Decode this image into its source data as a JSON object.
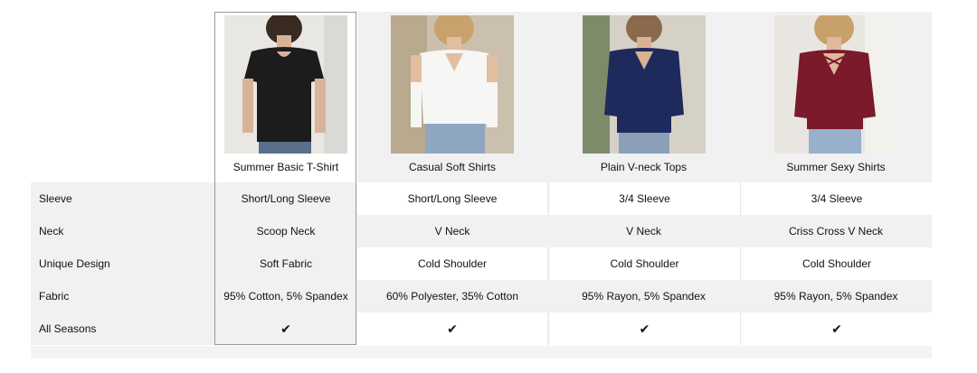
{
  "products": [
    {
      "name": "Summer Basic T-Shirt",
      "image_icon": "black-tshirt-photo",
      "color": "#1a1a1a"
    },
    {
      "name": "Casual Soft Shirts",
      "image_icon": "white-cold-shoulder-shirt-photo",
      "color": "#f4f4f2"
    },
    {
      "name": "Plain V-neck Tops",
      "image_icon": "navy-vneck-top-photo",
      "color": "#1f2a5c"
    },
    {
      "name": "Summer Sexy Shirts",
      "image_icon": "burgundy-criss-cross-shirt-photo",
      "color": "#7a1a2a"
    }
  ],
  "rows": [
    {
      "label": "Sleeve",
      "values": [
        "Short/Long Sleeve",
        "Short/Long Sleeve",
        "3/4 Sleeve",
        "3/4 Sleeve"
      ]
    },
    {
      "label": "Neck",
      "values": [
        "Scoop Neck",
        "V Neck",
        "V Neck",
        "Criss Cross V Neck"
      ]
    },
    {
      "label": "Unique Design",
      "values": [
        "Soft Fabric",
        "Cold Shoulder",
        "Cold Shoulder",
        "Cold Shoulder"
      ]
    },
    {
      "label": "Fabric",
      "values": [
        "95% Cotton, 5% Spandex",
        "60% Polyester, 35% Cotton",
        "95% Rayon, 5% Spandex",
        "95% Rayon, 5% Spandex"
      ]
    },
    {
      "label": "All Seasons",
      "values": [
        "✔",
        "✔",
        "✔",
        "✔"
      ]
    }
  ]
}
